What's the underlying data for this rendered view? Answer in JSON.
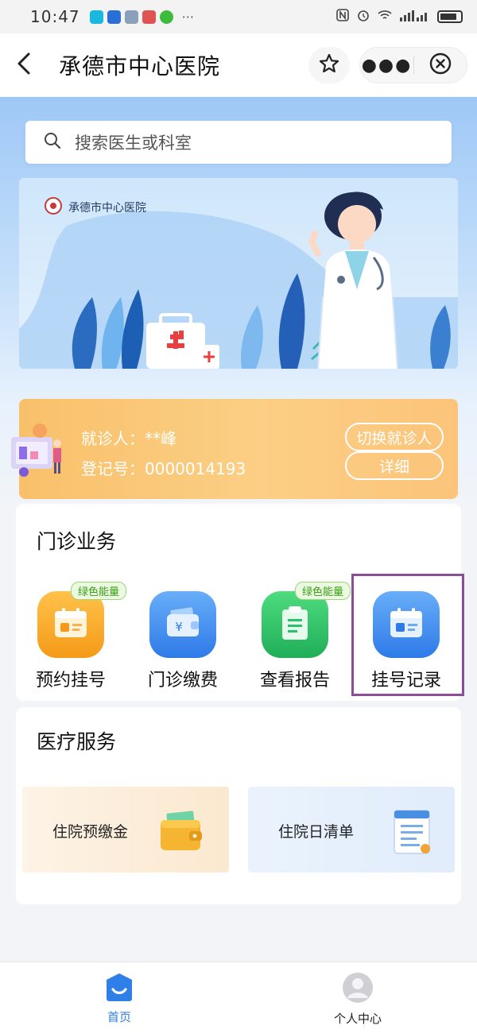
{
  "status_bar": {
    "time": "10:47",
    "more": "···",
    "network": "4G 4G"
  },
  "header": {
    "title": "承德市中心医院"
  },
  "search": {
    "placeholder": "搜索医生或科室"
  },
  "banner": {
    "hospital_name": "承德市中心医院"
  },
  "patient": {
    "name_label": "就诊人：",
    "name_value": "**峰",
    "id_label": "登记号：",
    "id_value": "0000014193",
    "switch_label": "切换就诊人",
    "detail_label": "详细"
  },
  "outpatient": {
    "title": "门诊业务",
    "items": [
      {
        "label": "预约挂号",
        "badge": "绿色能量",
        "icon": "calendar-icon",
        "color": "#f8a81b"
      },
      {
        "label": "门诊缴费",
        "badge": "",
        "icon": "wallet-yen-icon",
        "color": "#3f8cf0"
      },
      {
        "label": "查看报告",
        "badge": "绿色能量",
        "icon": "clipboard-icon",
        "color": "#2cc26b"
      },
      {
        "label": "挂号记录",
        "badge": "",
        "icon": "calendar-icon",
        "color": "#3c8ff0"
      }
    ]
  },
  "medical": {
    "title": "医疗服务",
    "items": [
      {
        "label": "住院预缴金",
        "icon": "wallet-icon"
      },
      {
        "label": "住院日清单",
        "icon": "document-icon"
      }
    ]
  },
  "tabs": [
    {
      "label": "首页",
      "icon": "home-icon",
      "active": true
    },
    {
      "label": "个人中心",
      "icon": "user-icon",
      "active": false
    }
  ],
  "colors": {
    "accent": "#3a86f0",
    "patient_card": "#fbc27a",
    "highlight_border": "#8a4e96"
  }
}
